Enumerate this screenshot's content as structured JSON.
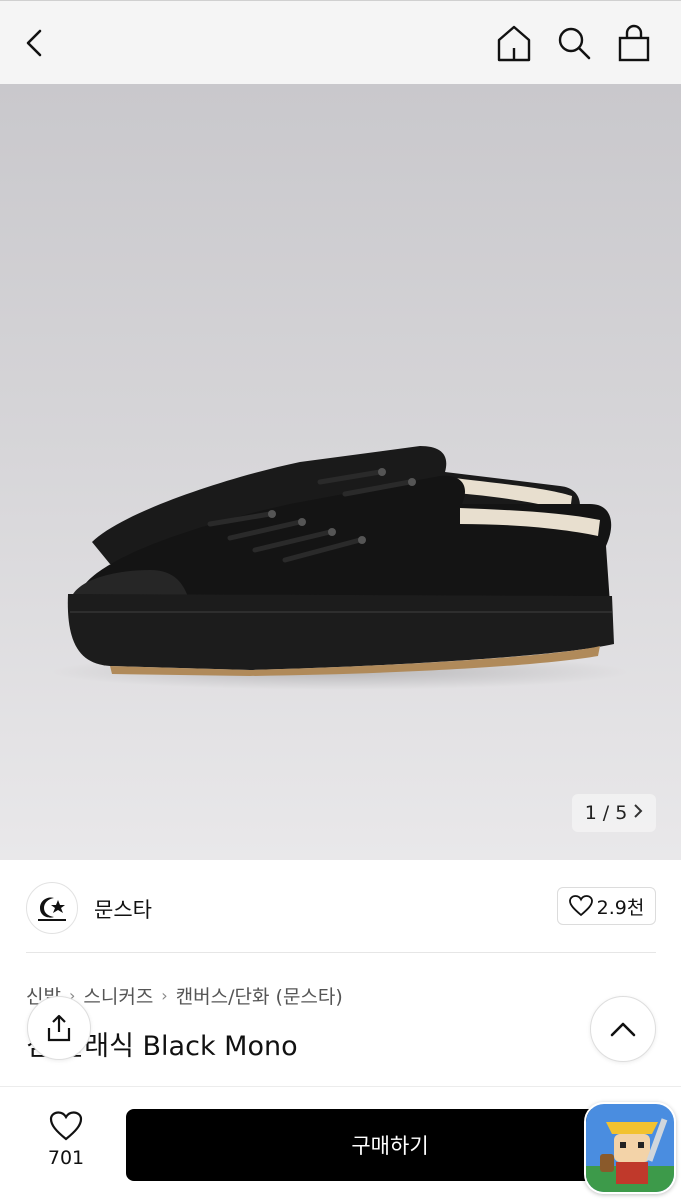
{
  "header": {
    "back_icon": "chevron-left-icon",
    "home_icon": "home-icon",
    "search_icon": "search-icon",
    "bag_icon": "shopping-bag-icon"
  },
  "gallery": {
    "current": "1",
    "separator": "/",
    "total": "5",
    "next_icon": "chevron-right-icon"
  },
  "brand": {
    "name": "문스타",
    "likes": "2.9천"
  },
  "breadcrumb": [
    "신발",
    "스니커즈",
    "캔버스/단화 (문스타)"
  ],
  "product": {
    "title": "짐 클래식 Black Mono"
  },
  "bottom": {
    "wish_count": "701",
    "buy_label": "구매하기"
  },
  "colors": {
    "accent": "#000000",
    "top_bar": "#f5f5f5"
  }
}
